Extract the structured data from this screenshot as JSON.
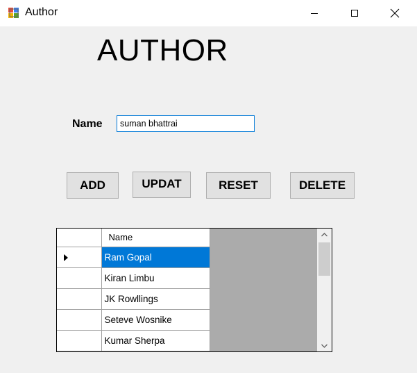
{
  "window": {
    "title": "Author",
    "minimize_icon": "minimize-icon",
    "maximize_icon": "maximize-icon",
    "close_icon": "close-icon"
  },
  "form": {
    "heading": "AUTHOR",
    "name_label": "Name",
    "name_value": "suman bhattrai"
  },
  "buttons": {
    "add": "ADD",
    "update": "UPDAT",
    "reset": "RESET",
    "delete": "DELETE"
  },
  "grid": {
    "column_header": "Name",
    "rows": [
      "Ram Gopal",
      "Kiran Limbu",
      "JK Rowllings",
      "Seteve Wosnike",
      "Kumar Sherpa"
    ],
    "selected_row": 0,
    "selection_color": "#0078d7"
  }
}
